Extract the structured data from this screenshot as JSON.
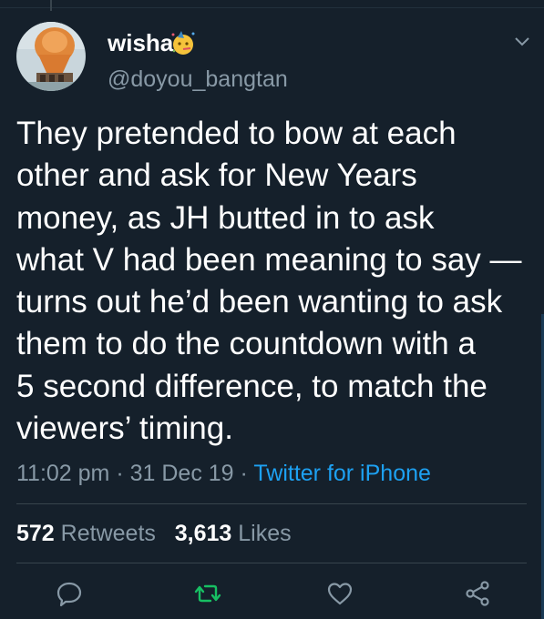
{
  "tweet": {
    "author": {
      "display_name": "wisha",
      "emoji_icon": "partying-face-icon",
      "handle": "@doyou_bangtan"
    },
    "text_lines": [
      "They pretended to bow at each",
      "other and ask for New Years",
      "money, as JH butted in to ask",
      "what V had been meaning to say —",
      "turns out he’d been wanting to ask",
      "them to do the countdown with a",
      "5 second difference, to match the",
      "viewers’ timing."
    ],
    "time": "11:02 pm",
    "separator": "·",
    "date": "31 Dec 19",
    "source": "Twitter for iPhone",
    "retweets_count": "572",
    "retweets_label": "Retweets",
    "likes_count": "3,613",
    "likes_label": "Likes"
  },
  "actions": {
    "reply_icon": "speech-bubble-icon",
    "retweet_icon": "retweet-arrows-icon",
    "like_icon": "heart-icon",
    "share_icon": "share-nodes-icon"
  },
  "colors": {
    "background": "#15202b",
    "secondary_text": "#8899a6",
    "link": "#1da1f2",
    "retweet_active": "#17bf63",
    "divider": "#38444d"
  }
}
